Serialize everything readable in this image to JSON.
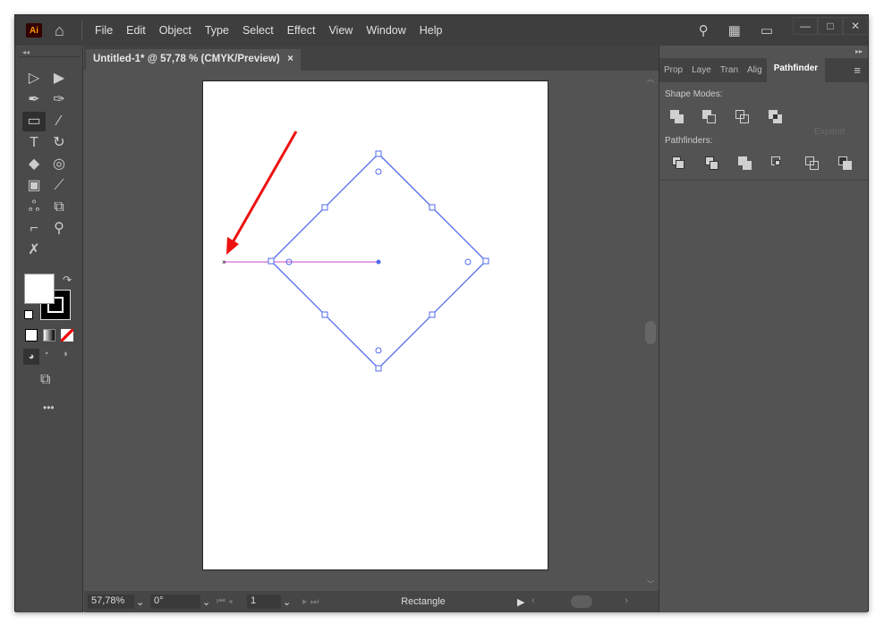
{
  "app": {
    "logo": "Ai",
    "menu": [
      "File",
      "Edit",
      "Object",
      "Type",
      "Select",
      "Effect",
      "View",
      "Window",
      "Help"
    ]
  },
  "document": {
    "tab_title": "Untitled-1* @ 57,78 % (CMYK/Preview)",
    "close": "×"
  },
  "panel": {
    "tabs": [
      "Prop",
      "Laye",
      "Tran",
      "Alig",
      "Pathfinder"
    ],
    "active_tab": "Pathfinder",
    "shape_modes_label": "Shape Modes:",
    "expand_label": "Expand",
    "pathfinders_label": "Pathfinders:"
  },
  "status": {
    "zoom": "57,78%",
    "rotation": "0°",
    "artboard": "1",
    "tool": "Rectangle"
  },
  "colors": {
    "selection": "#4f6bed",
    "guide": "#cc44cc",
    "annotation_arrow": "#ee1111"
  },
  "icons": {
    "search": "search-icon",
    "workspace": "workspace-icon",
    "arrange": "arrange-documents-icon"
  }
}
